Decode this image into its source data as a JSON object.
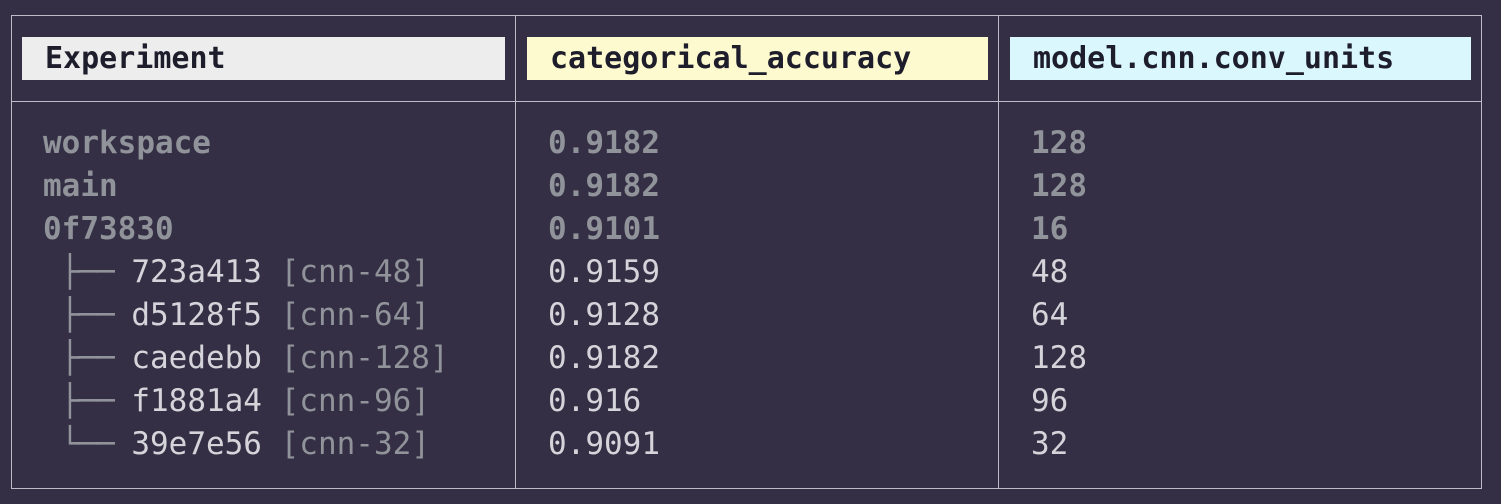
{
  "table": {
    "headers": {
      "experiment": "Experiment",
      "accuracy": "categorical_accuracy",
      "units": "model.cnn.conv_units"
    },
    "rows": [
      {
        "prefix": "",
        "name": "workspace",
        "tag": "",
        "accuracy": "0.9182",
        "units": "128",
        "emphasis": "bold"
      },
      {
        "prefix": "",
        "name": "main",
        "tag": "",
        "accuracy": "0.9182",
        "units": "128",
        "emphasis": "bold"
      },
      {
        "prefix": "",
        "name": "0f73830",
        "tag": "",
        "accuracy": "0.9101",
        "units": "16",
        "emphasis": "bold"
      },
      {
        "prefix": " ├── ",
        "name": "723a413 ",
        "tag": "[cnn-48]",
        "accuracy": "0.9159",
        "units": "48",
        "emphasis": "normal"
      },
      {
        "prefix": " ├── ",
        "name": "d5128f5 ",
        "tag": "[cnn-64]",
        "accuracy": "0.9128",
        "units": "64",
        "emphasis": "normal"
      },
      {
        "prefix": " ├── ",
        "name": "caedebb ",
        "tag": "[cnn-128]",
        "accuracy": "0.9182",
        "units": "128",
        "emphasis": "normal"
      },
      {
        "prefix": " ├── ",
        "name": "f1881a4 ",
        "tag": "[cnn-96]",
        "accuracy": "0.916",
        "units": "96",
        "emphasis": "normal"
      },
      {
        "prefix": " └── ",
        "name": "39e7e56 ",
        "tag": "[cnn-32]",
        "accuracy": "0.9091",
        "units": "32",
        "emphasis": "normal"
      }
    ]
  },
  "colors": {
    "background": "#342f44",
    "border": "#bdbdc9",
    "header_experiment": "#ededed",
    "header_accuracy": "#fefad0",
    "header_units": "#d9f7fd",
    "text_normal": "#d4d4da",
    "text_dim": "#90939a"
  }
}
